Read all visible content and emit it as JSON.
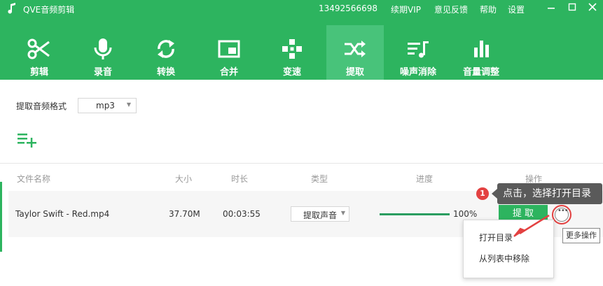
{
  "app": {
    "title": "QVE音频剪辑"
  },
  "header": {
    "phone": "13492566698",
    "links": [
      "续期VIP",
      "意见反馈",
      "帮助",
      "设置"
    ]
  },
  "toolbar": {
    "tools": [
      {
        "label": "剪辑",
        "icon": "scissors-icon"
      },
      {
        "label": "录音",
        "icon": "microphone-icon"
      },
      {
        "label": "转换",
        "icon": "convert-arrows-icon"
      },
      {
        "label": "合并",
        "icon": "merge-icon"
      },
      {
        "label": "变速",
        "icon": "speed-icon"
      },
      {
        "label": "提取",
        "icon": "shuffle-icon"
      },
      {
        "label": "噪声消除",
        "icon": "noise-reduction-icon"
      },
      {
        "label": "音量调整",
        "icon": "volume-bars-icon"
      }
    ],
    "active": "提取"
  },
  "format": {
    "label": "提取音频格式",
    "value": "mp3"
  },
  "table": {
    "headers": [
      "文件名称",
      "大小",
      "时长",
      "类型",
      "进度",
      "操作"
    ],
    "row": {
      "name": "Taylor Swift - Red.mp4",
      "size": "37.70M",
      "duration": "00:03:55",
      "type": "提取声音",
      "progress_fraction": 1.0,
      "progress_text": "100%",
      "action": "提 取"
    }
  },
  "context_menu": {
    "items": [
      "打开目录",
      "从列表中移除"
    ]
  },
  "tooltip": "更多操作",
  "annotation": {
    "step": "1",
    "text": "点击，选择打开目录"
  },
  "colors": {
    "brand": "#2db45f",
    "active_tab": "#48c37a",
    "accent_red": "#e34141"
  }
}
